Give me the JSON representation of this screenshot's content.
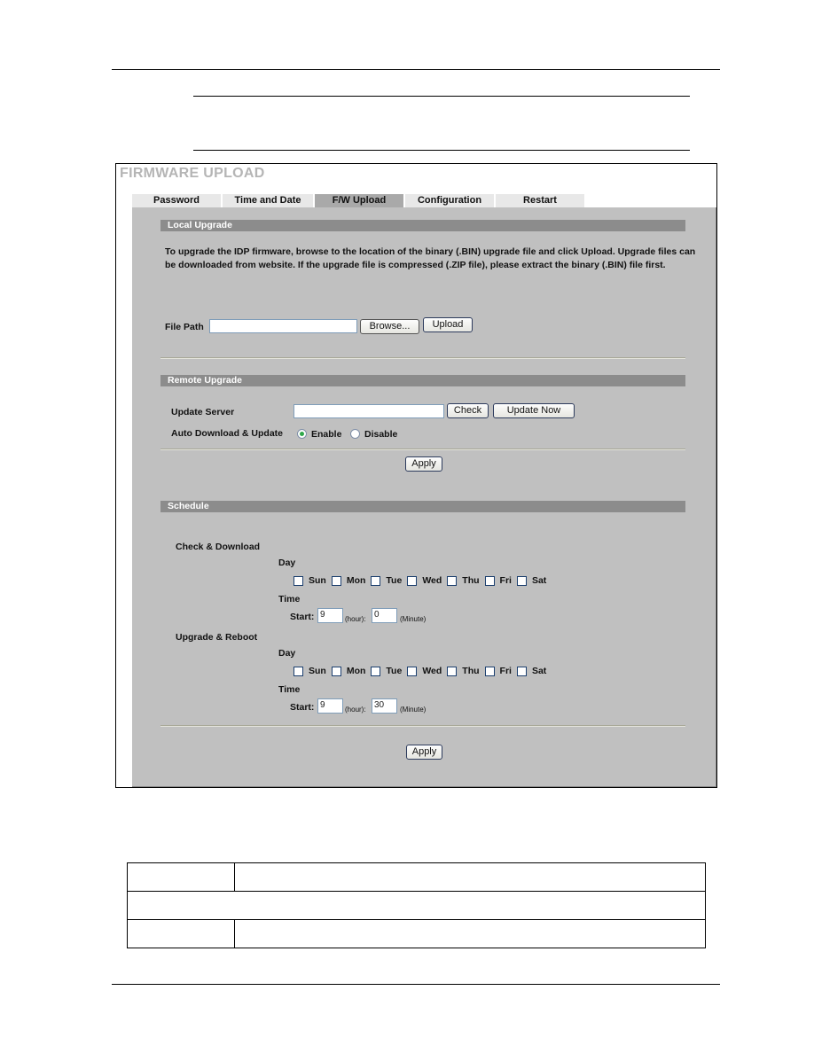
{
  "page": {
    "note_box": {
      "text": ""
    }
  },
  "firmware_page": {
    "title": "FIRMWARE UPLOAD",
    "tabs": [
      {
        "label": "Password",
        "active": false
      },
      {
        "label": "Time and Date",
        "active": false
      },
      {
        "label": "F/W Upload",
        "active": true
      },
      {
        "label": "Configuration",
        "active": false
      },
      {
        "label": "Restart",
        "active": false
      }
    ],
    "local_upgrade": {
      "heading": "Local Upgrade",
      "description": "To upgrade the IDP firmware, browse to the location of the binary (.BIN) upgrade file and click Upload. Upgrade files can be downloaded from website. If the upgrade file is compressed (.ZIP file), please extract the binary (.BIN) file first.",
      "file_path_label": "File Path",
      "file_path_value": "",
      "browse_label": "Browse...",
      "upload_label": "Upload"
    },
    "remote_upgrade": {
      "heading": "Remote Upgrade",
      "update_server_label": "Update Server",
      "update_server_value": "",
      "check_label": "Check",
      "update_now_label": "Update Now",
      "auto_label": "Auto Download & Update",
      "enable_label": "Enable",
      "disable_label": "Disable",
      "auto_selected": "Enable",
      "apply_label": "Apply"
    },
    "schedule": {
      "heading": "Schedule",
      "check_download": {
        "label": "Check & Download",
        "day_label": "Day",
        "days": [
          {
            "label": "Sun",
            "checked": false
          },
          {
            "label": "Mon",
            "checked": false
          },
          {
            "label": "Tue",
            "checked": false
          },
          {
            "label": "Wed",
            "checked": false
          },
          {
            "label": "Thu",
            "checked": false
          },
          {
            "label": "Fri",
            "checked": false
          },
          {
            "label": "Sat",
            "checked": false
          }
        ],
        "time_label": "Time",
        "start_label": "Start:",
        "hour_value": "9",
        "hour_unit": "(hour):",
        "minute_value": "0",
        "minute_unit": "(Minute)"
      },
      "upgrade_reboot": {
        "label": "Upgrade & Reboot",
        "day_label": "Day",
        "days": [
          {
            "label": "Sun",
            "checked": false
          },
          {
            "label": "Mon",
            "checked": false
          },
          {
            "label": "Tue",
            "checked": false
          },
          {
            "label": "Wed",
            "checked": false
          },
          {
            "label": "Thu",
            "checked": false
          },
          {
            "label": "Fri",
            "checked": false
          },
          {
            "label": "Sat",
            "checked": false
          }
        ],
        "time_label": "Time",
        "start_label": "Start:",
        "hour_value": "9",
        "hour_unit": "(hour):",
        "minute_value": "30",
        "minute_unit": "(Minute)"
      },
      "apply_label": "Apply"
    }
  },
  "reference_table": {
    "rows": [
      {
        "cells": [
          "",
          ""
        ]
      },
      {
        "cells": [
          ""
        ]
      },
      {
        "cells": [
          "",
          ""
        ]
      }
    ]
  }
}
